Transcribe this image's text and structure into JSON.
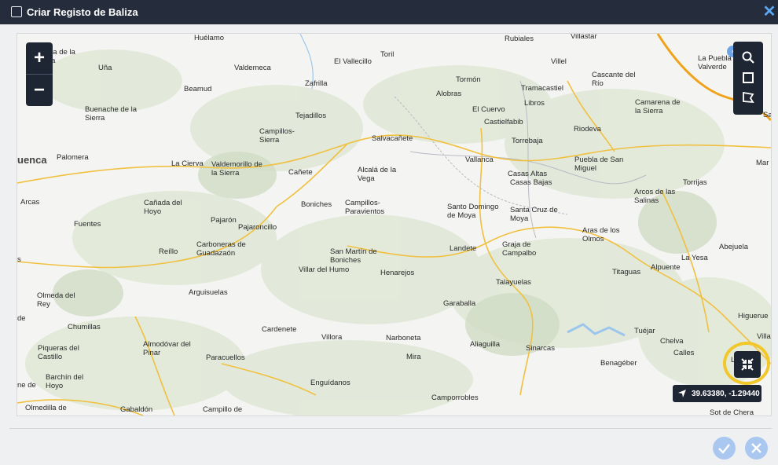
{
  "dialog": {
    "title": "Criar Registo de Baliza",
    "close_label": "✕"
  },
  "colors": {
    "titlebar": "#252c3b",
    "accent": "#5aa8f6",
    "highlight_ring": "#f2c72a",
    "map_controls": "#1e2533"
  },
  "map": {
    "zoom_in_label": "+",
    "zoom_out_label": "−",
    "coordinates": "39.63380, -1.29440",
    "tools": [
      "search-icon",
      "square-select-icon",
      "polygon-select-icon"
    ],
    "fullscreen_icon": "compress-icon",
    "places": [
      {
        "name": "Huélamo"
      },
      {
        "name": "Toril"
      },
      {
        "name": "Rubiales"
      },
      {
        "name": "Villastar"
      },
      {
        "name": "ba de la\nra"
      },
      {
        "name": "Uña"
      },
      {
        "name": "Valdemeca"
      },
      {
        "name": "El Vallecillo"
      },
      {
        "name": "Villel"
      },
      {
        "name": "La Puebla\nValverde"
      },
      {
        "name": "Tormón"
      },
      {
        "name": "Zafrilla"
      },
      {
        "name": "Tramacastiel"
      },
      {
        "name": "Cascante del\nRío"
      },
      {
        "name": "Beamud"
      },
      {
        "name": "Alobras"
      },
      {
        "name": "Libros"
      },
      {
        "name": "Camarena de\nla Sierra"
      },
      {
        "name": "Buenache de la\nSierra"
      },
      {
        "name": "El Cuervo"
      },
      {
        "name": "Castielfabib"
      },
      {
        "name": "Tejadillos"
      },
      {
        "name": "Riodeva"
      },
      {
        "name": "Sa"
      },
      {
        "name": "Campillos-\nSierra"
      },
      {
        "name": "Salvacañete"
      },
      {
        "name": "Torrebaja"
      },
      {
        "name": "uenca"
      },
      {
        "name": "Palomera"
      },
      {
        "name": "La Cierva"
      },
      {
        "name": "Valdemorillo de\nla Sierra"
      },
      {
        "name": "Cañete"
      },
      {
        "name": "Alcalá de la\nVega"
      },
      {
        "name": "Vallanca"
      },
      {
        "name": "Puebla de San\nMiguel"
      },
      {
        "name": "Mar"
      },
      {
        "name": "Casas Altas"
      },
      {
        "name": "Casas Bajas"
      },
      {
        "name": "Torrijas"
      },
      {
        "name": "Arcos de las\nSalinas"
      },
      {
        "name": "Arcas"
      },
      {
        "name": "Cañada del\nHoyo"
      },
      {
        "name": "Boniches"
      },
      {
        "name": "Campillos-\nParavientos"
      },
      {
        "name": "Santo Domingo\nde Moya"
      },
      {
        "name": "Santa Cruz de\nMoya"
      },
      {
        "name": "Pajarón"
      },
      {
        "name": "Fuentes"
      },
      {
        "name": "Pajaroncillo"
      },
      {
        "name": "Aras de los\nOlmos"
      },
      {
        "name": "Abejuela"
      },
      {
        "name": "s"
      },
      {
        "name": "Reíllo"
      },
      {
        "name": "Carboneras de\nGuadazaón"
      },
      {
        "name": "San Martín de\nBoniches"
      },
      {
        "name": "Landete"
      },
      {
        "name": "Graja de\nCampalbo"
      },
      {
        "name": "La Yesa"
      },
      {
        "name": "Alpuente"
      },
      {
        "name": "Villar del Humo"
      },
      {
        "name": "Henarejos"
      },
      {
        "name": "Titaguas"
      },
      {
        "name": "Talayuelas"
      },
      {
        "name": "Arguisuelas"
      },
      {
        "name": "Olmeda del\nRey"
      },
      {
        "name": "Garaballa"
      },
      {
        "name": "Higuerue"
      },
      {
        "name": "de"
      },
      {
        "name": "Chumillas"
      },
      {
        "name": "Cardenete"
      },
      {
        "name": "Tuéjar"
      },
      {
        "name": "Villa"
      },
      {
        "name": "Villora"
      },
      {
        "name": "Narboneta"
      },
      {
        "name": "Aliaguilla"
      },
      {
        "name": "Chelva"
      },
      {
        "name": "Almodóvar del\nPinar"
      },
      {
        "name": "Piqueras del\nCastillo"
      },
      {
        "name": "Sinarcas"
      },
      {
        "name": "Calles"
      },
      {
        "name": "Paracuellos"
      },
      {
        "name": "Mira"
      },
      {
        "name": "Benagéber"
      },
      {
        "name": "Barchín del\nHoyo"
      },
      {
        "name": "L"
      },
      {
        "name": "Enguídanos"
      },
      {
        "name": "ne de"
      },
      {
        "name": "Camporrobles"
      },
      {
        "name": "Olmedilla de"
      },
      {
        "name": "Gabaldón"
      },
      {
        "name": "Campillo de"
      },
      {
        "name": "Sot de Chera"
      }
    ]
  },
  "footer": {
    "confirm_icon": "check-icon",
    "cancel_icon": "close-icon"
  }
}
